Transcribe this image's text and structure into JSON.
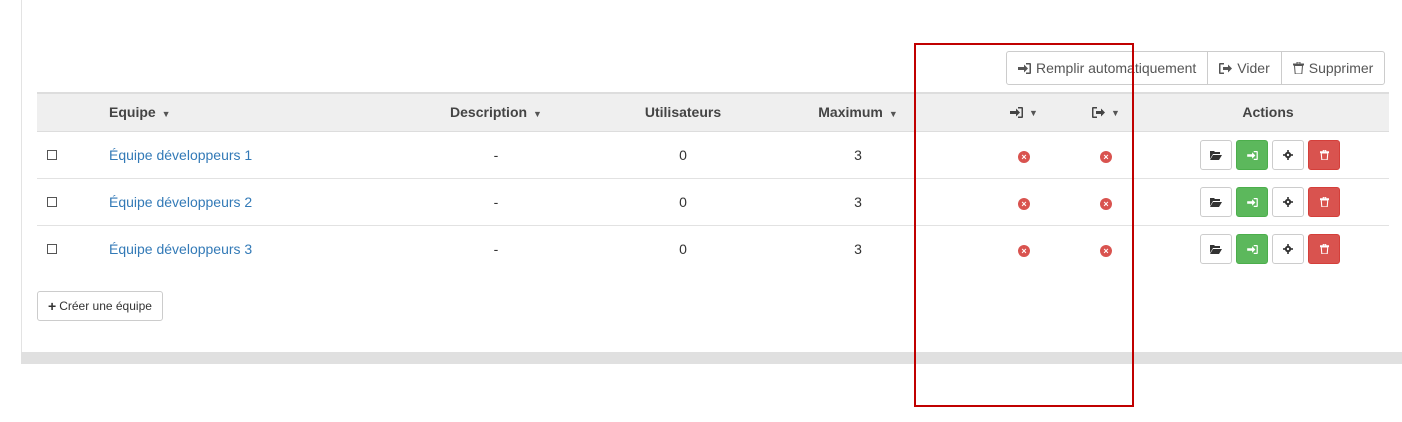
{
  "toolbar": {
    "autofill_label": "Remplir automatiquement",
    "autofill_icon": "sign-in-icon",
    "empty_label": "Vider",
    "empty_icon": "sign-out-icon",
    "delete_label": "Supprimer",
    "delete_icon": "trash-icon"
  },
  "table": {
    "headers": {
      "team": "Equipe",
      "description": "Description",
      "users": "Utilisateurs",
      "maximum": "Maximum",
      "self_register_icon": "sign-in-icon",
      "self_unregister_icon": "sign-out-icon",
      "actions": "Actions"
    },
    "rows": [
      {
        "name": "Équipe développeurs 1",
        "description": "-",
        "users": "0",
        "maximum": "3",
        "self_register": "no",
        "self_unregister": "no"
      },
      {
        "name": "Équipe développeurs 2",
        "description": "-",
        "users": "0",
        "maximum": "3",
        "self_register": "no",
        "self_unregister": "no"
      },
      {
        "name": "Équipe développeurs 3",
        "description": "-",
        "users": "0",
        "maximum": "3",
        "self_register": "no",
        "self_unregister": "no"
      }
    ],
    "row_actions": [
      "folder-open-icon",
      "sign-in-icon",
      "gear-icon",
      "trash-icon"
    ]
  },
  "create_button": {
    "label": "Créer une équipe",
    "icon": "plus-icon"
  },
  "colors": {
    "link": "#337ab7",
    "success": "#5cb85c",
    "danger": "#d9534f",
    "highlight": "#c00000"
  }
}
